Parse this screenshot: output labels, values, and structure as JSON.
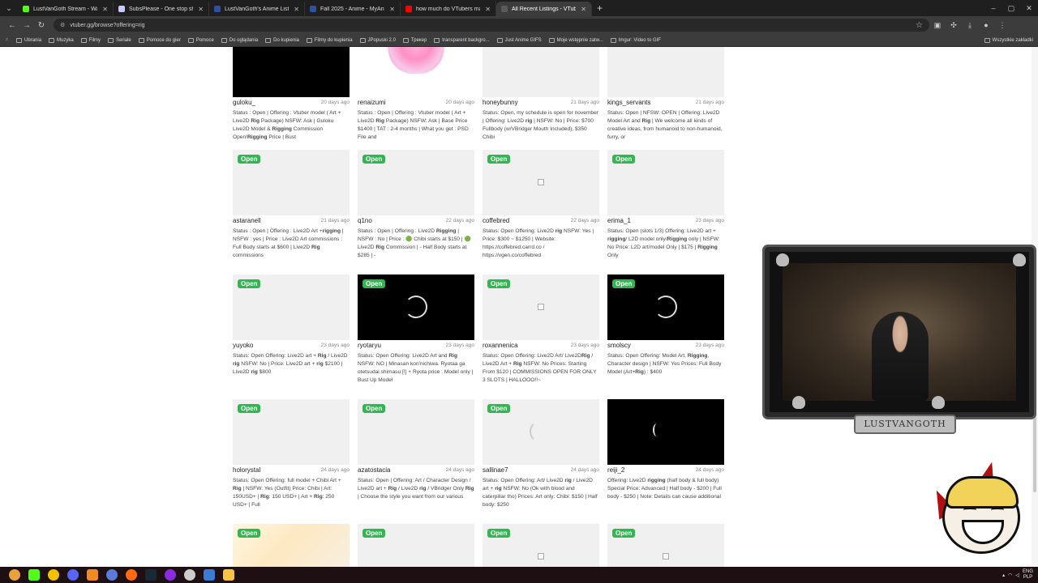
{
  "browser": {
    "tabs": [
      {
        "title": "LustVanGoth Stream - Watch Li",
        "color": "#53fc18",
        "active": false
      },
      {
        "title": "SubsPlease - One stop shop fo",
        "color": "#c9c9ff",
        "active": false
      },
      {
        "title": "LustVanGoth's Anime List - My",
        "color": "#2e51a2",
        "active": false
      },
      {
        "title": "Fall 2025 - Anime - MyAnimeLi",
        "color": "#2e51a2",
        "active": false
      },
      {
        "title": "how much do VTubers make?",
        "color": "#ff0000",
        "active": false
      },
      {
        "title": "All Recent Listings - VTuber M",
        "color": "#5a5a5a",
        "active": true
      }
    ],
    "url": "vtuber.gg/browse?offering=rig",
    "bookmarks": [
      "Ubrania",
      "Muzyka",
      "Filmy",
      "Seriale",
      "Pomoce do gier",
      "Pomoce",
      "Do oglądania",
      "Do kupienia",
      "Filmy do kupienia",
      "JPopuski 2.0",
      "Трекер",
      "transparent backgro...",
      "Just Anime GIFS",
      "Moje wstępnie zatw...",
      "Imgur: Video to GIF"
    ],
    "bookmarks_right": "Wszystkie zakładki"
  },
  "listings": [
    {
      "name": "guloku_",
      "ago": "20 days ago",
      "thumb": "dark",
      "open": false,
      "desc": [
        "Status : Open | Offering : Vtuber model ( Art",
        "+ Live2D ",
        {
          "b": "Rig"
        },
        " Package) NSFW: Ask | Guloku",
        "Live2D Model & ",
        {
          "b": "Rigging"
        },
        " Commission Open!",
        {
          "b": "Rigging"
        },
        " Price | Bust"
      ]
    },
    {
      "name": "renaizumi",
      "ago": "20 days ago",
      "thumb": "anime",
      "open": false,
      "desc": [
        "Status : Open | Offering : Vtuber model ( Art",
        "+ Live2D ",
        {
          "b": "Rig"
        },
        " Package) NSFW: Ask | Base",
        "Price $1400 | TAT : 2-4 months | What you get",
        ": PSD File and"
      ]
    },
    {
      "name": "honeybunny",
      "ago": "21 days ago",
      "thumb": "blank",
      "open": false,
      "desc": [
        "Status: Open, my schedule is open for",
        "november | Offering: Live2D ",
        {
          "b": "rig"
        },
        " | NSFW: No |",
        "Price: $700 Fullbody (w/VBridger Mouth",
        "Included), $350 Chibi"
      ]
    },
    {
      "name": "kings_servants",
      "ago": "21 days ago",
      "thumb": "blank",
      "open": false,
      "desc": [
        "Status: Open | NFSW: OPEN | Offering:",
        "Live2D Model Art and ",
        {
          "b": "Rig"
        },
        " | We welcome all",
        "kinds of creative ideas, from humanoid to",
        "non-humanoid, furry, or"
      ]
    },
    {
      "name": "astaranell",
      "ago": "21 days ago",
      "thumb": "blank",
      "open": true,
      "desc": [
        "Status : Open | Offering : Live2D Art +",
        {
          "b": "rigging"
        },
        " | NSFW : yes | Price : Live2D Art",
        "commissions : Full Body starts at $600 |",
        "Live2D ",
        {
          "b": "Rig"
        },
        " commissions"
      ]
    },
    {
      "name": "q1no",
      "ago": "22 days ago",
      "thumb": "blank",
      "open": true,
      "desc": [
        "Status : Open | Offering : Live2D ",
        {
          "b": "Rigging"
        },
        " |",
        "NSFW : No | Price : 🟢 Chibi starts at $150 |",
        "🟢 Live2D ",
        {
          "b": "Rig"
        },
        " Commission | - Half Body",
        "starts at $285 | -"
      ]
    },
    {
      "name": "coffebred",
      "ago": "22 days ago",
      "thumb": "broken",
      "open": true,
      "desc": [
        "Status: Open Offering: Live2D ",
        {
          "b": "rig"
        },
        " NSFW: Yes",
        "| Price: $300 ~ $1250 | Website:",
        "https://coffebred.carrd.co /",
        "https://vgen.co/coffebred"
      ]
    },
    {
      "name": "erima_1",
      "ago": "23 days ago",
      "thumb": "blank",
      "open": true,
      "desc": [
        "Status: Open (slots 1/3) Offering: Live2D art",
        "+ ",
        {
          "b": "rigging"
        },
        "/ L2D model only/",
        {
          "b": "Rigging"
        },
        " only |",
        "NSFW: No Price: L2D art/model Only | $175",
        "| ",
        {
          "b": "Rigging"
        },
        " Only"
      ]
    },
    {
      "name": "yuyoko",
      "ago": "23 days ago",
      "thumb": "blank",
      "open": true,
      "desc": [
        "Status: Open Offering: Live2D art + ",
        {
          "b": "Rig"
        },
        " /",
        "Live2D ",
        {
          "b": "rig"
        },
        " NSFW: No | Price: Live2D art + ",
        {
          "b": "rig"
        },
        "",
        "$2100 | Live2D ",
        {
          "b": "rig"
        },
        " $800"
      ]
    },
    {
      "name": "ryotaryu",
      "ago": "23 days ago",
      "thumb": "dark-spin",
      "open": true,
      "desc": [
        "Status: Open Offering: Live2D Art and ",
        {
          "b": "Rig"
        },
        "",
        "NSFW: NO | Minasan kon'nichiwa. Ryotaa ga",
        "otetsudai shimasu [!] + Ryota price : Model",
        "only | Bust Up Model"
      ]
    },
    {
      "name": "roxannenica",
      "ago": "23 days ago",
      "thumb": "broken",
      "open": true,
      "desc": [
        "Status: Open Offering: Live2D Art/ Live2D",
        {
          "b": "Rig"
        },
        " / Live2D Art + ",
        {
          "b": "Rig"
        },
        " NSFW: No Prices:",
        "Starting From $120 | COMMISSIONS OPEN",
        "FOR ONLY 3 SLOTS | HALLOOO!!~"
      ]
    },
    {
      "name": "smolscy",
      "ago": "23 days ago",
      "thumb": "dark-spin",
      "open": true,
      "desc": [
        "Status: Open Offering: Model Art, ",
        {
          "b": "Rigging"
        },
        ",",
        "Character design | NSFW: Yes Prices: Full",
        "Body Model (Art+",
        {
          "b": "Rig"
        },
        ") : $400"
      ]
    },
    {
      "name": "holorystal",
      "ago": "24 days ago",
      "thumb": "blank",
      "open": true,
      "desc": [
        "Status: Open Offering: full model + Chibi Art",
        "+ ",
        {
          "b": "Rig"
        },
        " | NSFW: Yes (Outfit) Price: Chibi | Art:",
        "150USD+ | ",
        {
          "b": "Rig"
        },
        ": 150 USD+ | Art + ",
        {
          "b": "Rig"
        },
        ": 250",
        "USD+ | Full"
      ]
    },
    {
      "name": "azatostacia",
      "ago": "24 days ago",
      "thumb": "blank",
      "open": true,
      "desc": [
        "Status: Open | Offering: Art / Character",
        "Design / Live2D art + ",
        {
          "b": "Rig"
        },
        " / Live2D ",
        {
          "b": "rig"
        },
        " /",
        "VBridger Only ",
        {
          "b": "Rig"
        },
        " | Choose the style you",
        "want from our various"
      ]
    },
    {
      "name": "sallinae7",
      "ago": "24 days ago",
      "thumb": "light-spin",
      "open": true,
      "desc": [
        "Status: Open Offering: Art/ Live2D ",
        {
          "b": "rig"
        },
        " /",
        "Live2D art + ",
        {
          "b": "rig"
        },
        " NSFW: No (Ok with blood",
        "and caterpillar tho) Prices: Art only: Chibi:",
        "$150 | Half body: $250"
      ]
    },
    {
      "name": "reiji_2",
      "ago": "24 days ago",
      "thumb": "dark-small",
      "open": false,
      "desc": [
        "Offering: Live2D ",
        {
          "b": "rigging"
        },
        " (half body & full",
        "body) Special Price: Advanced | Half body -",
        "$200 | Full body - $250 | Note: Details can",
        "cause additional"
      ]
    },
    {
      "name": "",
      "ago": "",
      "thumb": "yellowish",
      "open": true,
      "desc": []
    },
    {
      "name": "",
      "ago": "",
      "thumb": "blank",
      "open": true,
      "desc": []
    },
    {
      "name": "",
      "ago": "",
      "thumb": "broken",
      "open": true,
      "desc": []
    },
    {
      "name": "",
      "ago": "",
      "thumb": "broken",
      "open": true,
      "desc": []
    }
  ],
  "badge_label": "Open",
  "overlay": {
    "nameplate": "LUSTVANGOTH"
  },
  "tray": {
    "lang_top": "ENG",
    "lang_bottom": "PLP"
  }
}
